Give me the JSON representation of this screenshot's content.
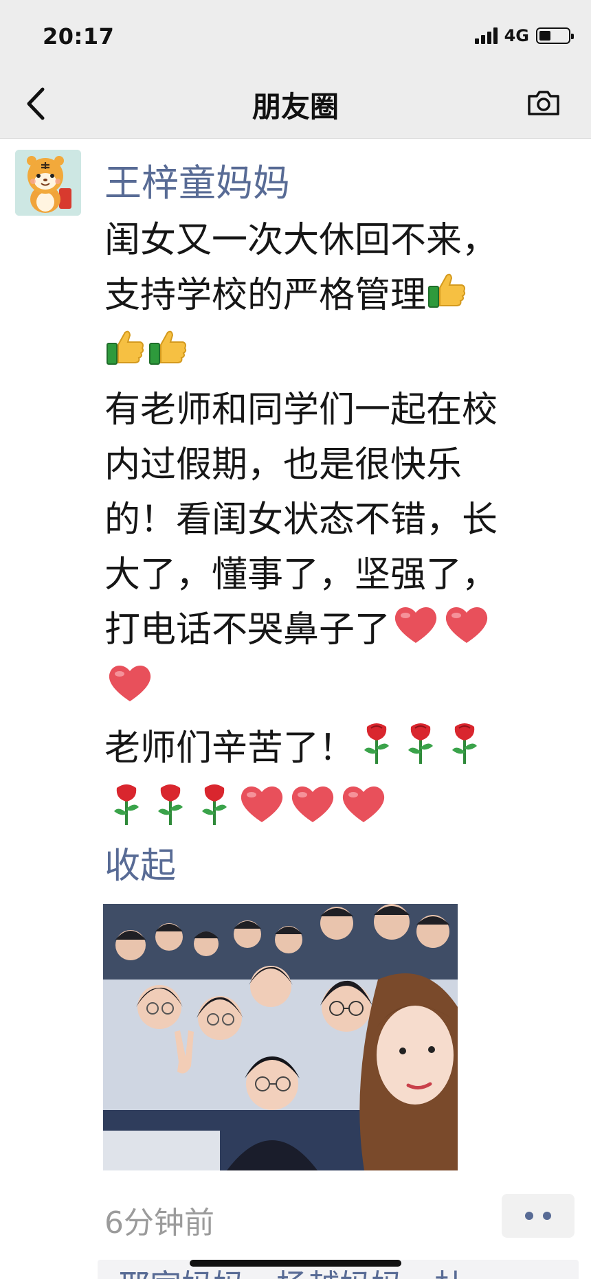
{
  "status_bar": {
    "time": "20:17",
    "network": "4G",
    "battery_level_percent": 40
  },
  "nav": {
    "title": "朋友圈",
    "back_icon": "chevron-left-icon",
    "camera_icon": "camera-icon"
  },
  "post": {
    "author": "王梓童妈妈",
    "lines": [
      "闺女又一次大休回不来，",
      "支持学校的严格管理",
      "",
      "有老师和同学们一起在校",
      "内过假期，也是很快乐",
      "的！看闺女状态不错，长",
      "大了，懂事了，坚强了，",
      "打电话不哭鼻子了",
      "",
      "老师们辛苦了！",
      ""
    ],
    "emoji_names": [
      "thumbs-up-icon",
      "heart-icon",
      "rose-icon"
    ],
    "collapse_label": "收起",
    "time_ago": "6分钟前",
    "likes_preview": "邢家妈妈，杨越妈妈，杜"
  },
  "colors": {
    "link": "#586b95",
    "nav_bg": "#ededed",
    "text": "#161616",
    "muted": "#9b9b9b"
  }
}
